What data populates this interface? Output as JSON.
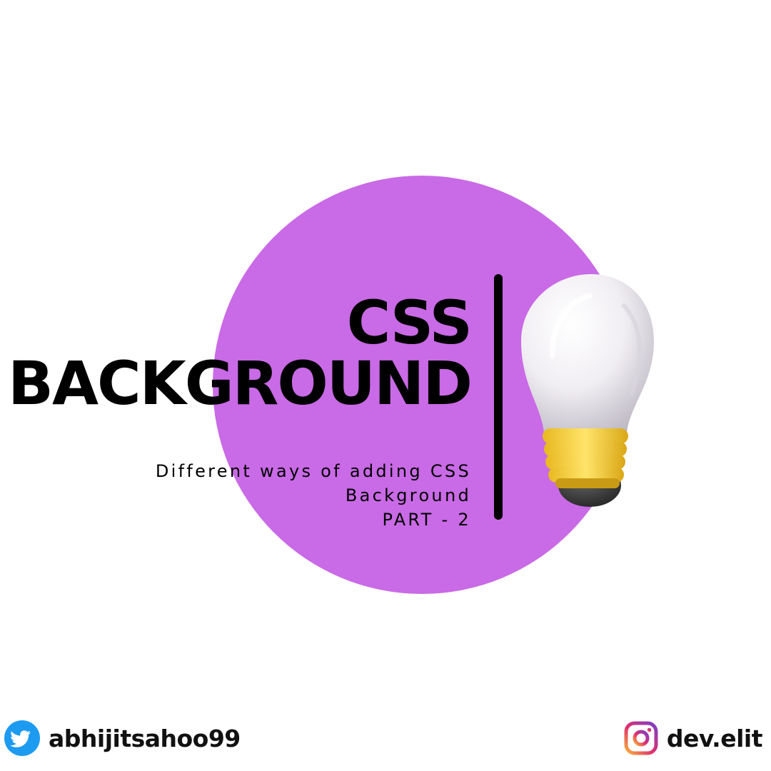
{
  "headline": {
    "line1": "CSS",
    "line2": "BACKGROUND"
  },
  "subtitle": {
    "line1": "Different ways of adding CSS",
    "line2": "Background",
    "line3": "PART - 2"
  },
  "social": {
    "twitter_handle": "abhijitsahoo99",
    "instagram_handle": "dev.elit"
  },
  "colors": {
    "accent_circle": "#c96ae6",
    "twitter_blue": "#1d9bf0",
    "bulb_base": "#f2cf3a"
  },
  "icons": {
    "twitter": "twitter-bird-icon",
    "instagram": "instagram-camera-icon",
    "bulb": "light-bulb-icon"
  }
}
